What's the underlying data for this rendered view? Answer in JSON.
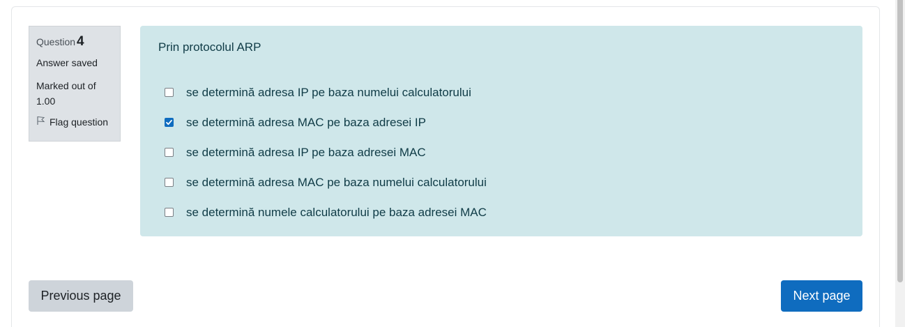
{
  "question_info": {
    "label": "Question",
    "number": "4",
    "state": "Answer saved",
    "grade": "Marked out of 1.00",
    "flag_label": "Flag question"
  },
  "question": {
    "text": "Prin protocolul ARP",
    "answers": [
      {
        "label": "se determină adresa IP pe baza numelui calculatorului",
        "checked": false
      },
      {
        "label": "se determină adresa MAC pe baza adresei IP",
        "checked": true
      },
      {
        "label": "se determină adresa IP pe baza adresei MAC",
        "checked": false
      },
      {
        "label": "se determină adresa MAC pe baza numelui calculatorului",
        "checked": false
      },
      {
        "label": "se determină numele calculatorului pe baza adresei MAC",
        "checked": false
      }
    ]
  },
  "navigation": {
    "previous_label": "Previous page",
    "next_label": "Next page"
  },
  "colors": {
    "accent": "#0f6cbf",
    "formulation_bg": "#cfe7ea",
    "info_bg": "#dee2e6"
  }
}
